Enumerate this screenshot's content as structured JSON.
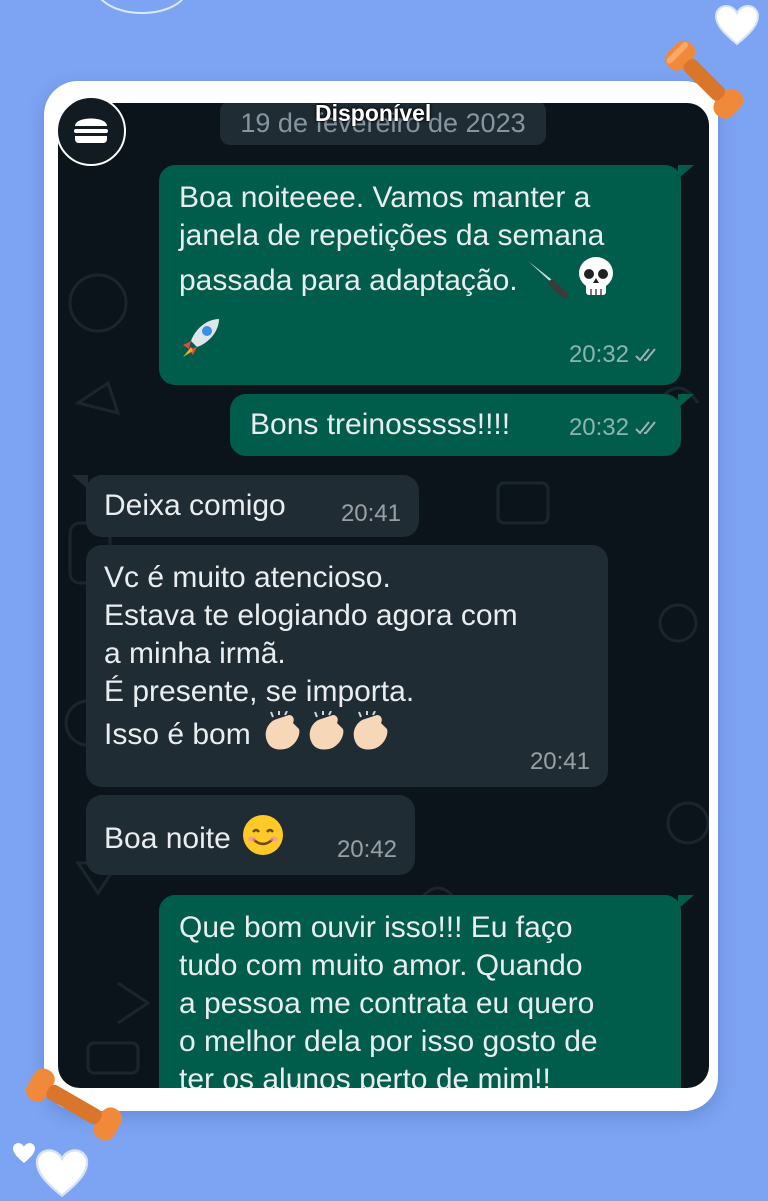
{
  "chat": {
    "date": "19 de fevereiro de 2023",
    "status": "Disponível"
  },
  "messages": [
    {
      "direction": "out",
      "text": "Boa noiteeee. Vamos manter a\njanela de repetições da semana\npassada para adaptação.",
      "emojis": [
        "knife-icon",
        "skull-icon",
        "rocket-icon"
      ],
      "time": "20:32",
      "status": "read-ticks"
    },
    {
      "direction": "out",
      "text": "Bons treinosssss!!!!",
      "time": "20:32",
      "status": "read-ticks"
    },
    {
      "direction": "in",
      "text": "Deixa comigo",
      "time": "20:41"
    },
    {
      "direction": "in",
      "text": "Vc é muito atencioso.\nEstava te elogiando agora com\na minha irmã.\nÉ presente, se importa.\nIsso é bom",
      "emojis": [
        "clapping-hands-icon",
        "clapping-hands-icon",
        "clapping-hands-icon"
      ],
      "time": "20:41"
    },
    {
      "direction": "in",
      "text": "Boa noite",
      "emojis": [
        "smiling-face-icon"
      ],
      "time": "20:42"
    },
    {
      "direction": "out",
      "text": "Que bom ouvir isso!!! Eu faço\ntudo com muito amor. Quando\na pessoa me contrata eu quero\no melhor dela por isso gosto de\nter os alunos perto de mim!!",
      "time": ""
    }
  ],
  "colors": {
    "page_bg": "#7da4f2",
    "chat_bg": "#0b141a",
    "outgoing_bubble": "#005c4b",
    "incoming_bubble": "#202c33",
    "text": "#e9edef",
    "timestamp": "#8696a0",
    "dumbbell": "#f08a3a"
  }
}
